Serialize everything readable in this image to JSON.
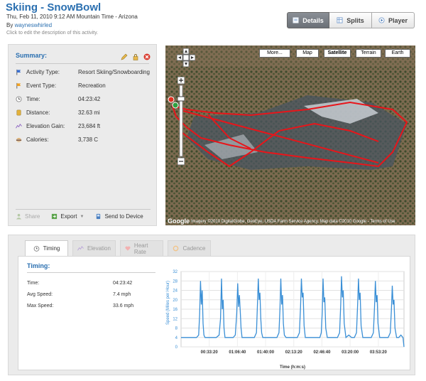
{
  "header": {
    "title": "Skiing - SnowBowl",
    "datetime": "Thu, Feb 11, 2010 9:12 AM Mountain Time - Arizona",
    "by_prefix": "By",
    "user": "wayneswhirled",
    "hint": "Click to edit the description of this activity."
  },
  "view_tabs": [
    {
      "label": "Details",
      "active": true,
      "icon": "details-icon"
    },
    {
      "label": "Splits",
      "active": false,
      "icon": "splits-icon"
    },
    {
      "label": "Player",
      "active": false,
      "icon": "player-icon"
    }
  ],
  "summary": {
    "heading": "Summary:",
    "rows": [
      {
        "label": "Activity Type:",
        "value": "Resort Skiing/Snowboarding",
        "icon": "activity-flag-icon"
      },
      {
        "label": "Event Type:",
        "value": "Recreation",
        "icon": "event-flag-icon"
      },
      {
        "label": "Time:",
        "value": "04:23:42",
        "icon": "clock-icon"
      },
      {
        "label": "Distance:",
        "value": "32.63 mi",
        "icon": "distance-icon"
      },
      {
        "label": "Elevation Gain:",
        "value": "23,684 ft",
        "icon": "elevation-icon"
      },
      {
        "label": "Calories:",
        "value": "3,738 C",
        "icon": "calories-icon"
      }
    ],
    "footer": {
      "share": "Share",
      "export": "Export",
      "send": "Send to Device"
    }
  },
  "map": {
    "more": "More...",
    "types": [
      "Map",
      "Satellite",
      "Terrain",
      "Earth"
    ],
    "selected": "Satellite",
    "copyright": "Imagery ©2010 DigitalGlobe, GeoEye, USDA Farm Service Agency, Map data ©2010 Google - Terms of Use",
    "logo": "Google"
  },
  "bottom_tabs": [
    {
      "label": "Timing",
      "active": true
    },
    {
      "label": "Elevation",
      "active": false
    },
    {
      "label": "Heart Rate",
      "active": false
    },
    {
      "label": "Cadence",
      "active": false
    }
  ],
  "timing": {
    "heading": "Timing:",
    "rows": [
      {
        "label": "Time:",
        "value": "04:23:42"
      },
      {
        "label": "Avg Speed:",
        "value": "7.4 mph"
      },
      {
        "label": "Max Speed:",
        "value": "33.6 mph"
      }
    ]
  },
  "colors": {
    "accent": "#2a6fb0",
    "track": "#e8151a",
    "line": "#3a8fd6"
  },
  "chart_data": {
    "type": "line",
    "title": "",
    "xlabel": "Time (h:m:s)",
    "ylabel": "Speed (Miles per Hour)",
    "ylim": [
      0,
      32
    ],
    "xlim": [
      0,
      15822
    ],
    "yticks": [
      0,
      4,
      8,
      12,
      16,
      20,
      24,
      28,
      32
    ],
    "xticks": [
      2000,
      4000,
      6000,
      8000,
      10000,
      12000,
      14000
    ],
    "xtick_labels": [
      "00:33:20",
      "01:06:40",
      "01:40:00",
      "02:13:20",
      "02:46:40",
      "03:20:00",
      "03:53:20"
    ],
    "grid": true,
    "series": [
      {
        "x": [
          0,
          300,
          600,
          900,
          1100,
          1250,
          1320,
          1380,
          1440,
          1500,
          1560,
          1620,
          1700,
          1800,
          2000,
          2300,
          2500,
          2700,
          2800,
          2870,
          2930,
          2990,
          3050,
          3120,
          3200,
          3400,
          3700,
          3850,
          3950,
          4020,
          4080,
          4140,
          4200,
          4260,
          4330,
          4450,
          4700,
          5000,
          5200,
          5350,
          5420,
          5480,
          5540,
          5600,
          5660,
          5720,
          5800,
          6000,
          6300,
          6600,
          6800,
          6950,
          7020,
          7080,
          7140,
          7200,
          7260,
          7330,
          7450,
          7700,
          8000,
          8250,
          8400,
          8480,
          8540,
          8600,
          8660,
          8730,
          8820,
          9000,
          9300,
          9600,
          9850,
          9950,
          10020,
          10080,
          10140,
          10200,
          10270,
          10380,
          10600,
          10900,
          11100,
          11250,
          11330,
          11390,
          11450,
          11510,
          11580,
          11700,
          11900,
          12100,
          12300,
          12450,
          12530,
          12590,
          12650,
          12710,
          12780,
          12900,
          13100,
          13300,
          13500,
          13650,
          13730,
          13790,
          13850,
          13910,
          13980,
          14100,
          14300,
          14500,
          14700,
          14850,
          14930,
          14990,
          15050,
          15110,
          15180,
          15300,
          15450,
          15600,
          15750,
          15822
        ],
        "y": [
          4,
          4,
          4,
          4,
          4,
          5,
          14,
          28,
          18,
          24,
          10,
          5,
          4,
          4,
          4,
          4,
          4,
          5,
          12,
          29,
          16,
          20,
          8,
          4,
          4,
          4,
          4,
          5,
          14,
          27,
          17,
          22,
          15,
          8,
          4,
          4,
          4,
          4,
          4,
          6,
          18,
          29,
          20,
          23,
          12,
          6,
          4,
          4,
          4,
          4,
          4,
          6,
          16,
          29,
          18,
          22,
          10,
          5,
          4,
          4,
          4,
          4,
          6,
          17,
          29,
          21,
          23,
          9,
          4,
          4,
          4,
          4,
          4,
          6,
          15,
          29,
          19,
          21,
          8,
          4,
          4,
          4,
          4,
          6,
          18,
          30,
          21,
          24,
          10,
          4,
          5,
          4,
          4,
          6,
          18,
          29,
          20,
          23,
          9,
          4,
          4,
          4,
          4,
          6,
          17,
          28,
          19,
          22,
          10,
          4,
          4,
          4,
          4,
          6,
          16,
          26,
          18,
          20,
          8,
          4,
          4,
          5,
          4,
          0
        ]
      }
    ]
  }
}
